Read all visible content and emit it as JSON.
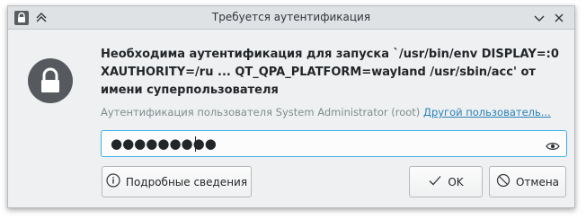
{
  "window": {
    "title": "Требуется аутентификация",
    "buttons": {
      "lock_icon": "lock-icon",
      "pin_icon": "keep-above-icon",
      "minimize_icon": "chevron-down-icon",
      "close_icon": "close-icon"
    }
  },
  "dialog": {
    "icon": "padlock-icon",
    "message": "Необходима аутентификация для запуска `/usr/bin/env DISPLAY=:0 XAUTHORITY=/ru ... QT_QPA_PLATFORM=wayland /usr/sbin/acc' от имени суперпользователя",
    "user_prefix": "Аутентификация пользователя System Administrator (root)",
    "other_user_link": "Другой пользователь...",
    "password": {
      "masked_value": "●●●●●●●●●",
      "reveal_icon": "eye-icon"
    },
    "buttons": {
      "details": "Подробные сведения",
      "ok": "OK",
      "cancel": "Отмена"
    }
  },
  "colors": {
    "accent": "#3daee9",
    "link": "#2980b9",
    "window_bg": "#eff0f1",
    "titlebar_bg": "#dfe2e4"
  }
}
